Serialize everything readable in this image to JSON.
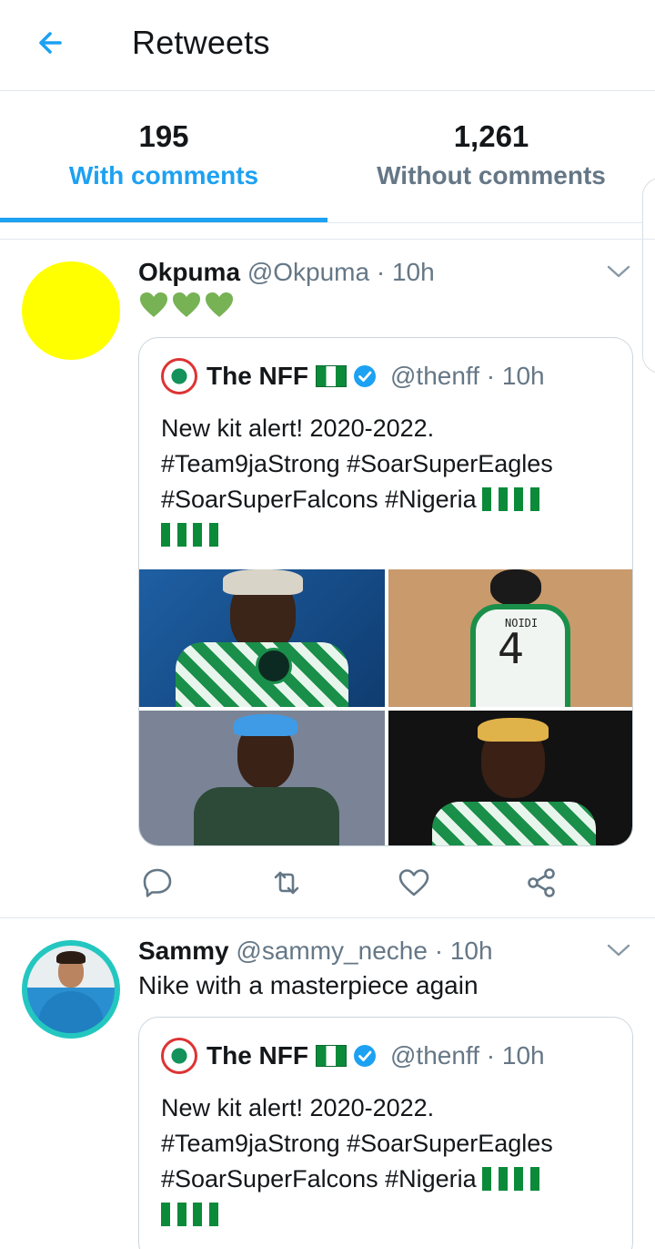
{
  "header": {
    "title": "Retweets",
    "back_icon": "arrow-left-icon"
  },
  "tabs": [
    {
      "count": "195",
      "label": "With comments",
      "active": true
    },
    {
      "count": "1,261",
      "label": "Without comments",
      "active": false
    }
  ],
  "colors": {
    "accent": "#1da1f2",
    "muted": "#657786",
    "text": "#14171a",
    "border": "#e1e8ed"
  },
  "tweets": [
    {
      "name": "Okpuma",
      "handle": "@Okpuma",
      "dot": "·",
      "time": "10h",
      "text": "💚💚💚",
      "quote": {
        "name": "The NFF",
        "handle": "@thenff",
        "dot": "·",
        "time": "10h",
        "text": "New kit alert! 2020-2022. #Team9jaStrong #SoarSuperEagles #SoarSuperFalcons #Nigeria",
        "media_count": 4,
        "shirt_name": "NOIDI",
        "shirt_number": "4"
      }
    },
    {
      "name": "Sammy",
      "handle": "@sammy_neche",
      "dot": "·",
      "time": "10h",
      "text": "Nike with a masterpiece again",
      "quote": {
        "name": "The NFF",
        "handle": "@thenff",
        "dot": "·",
        "time": "10h",
        "text": "New kit alert! 2020-2022. #Team9jaStrong #SoarSuperEagles #SoarSuperFalcons #Nigeria"
      }
    }
  ],
  "actions": [
    "reply-icon",
    "retweet-icon",
    "like-icon",
    "share-icon"
  ]
}
